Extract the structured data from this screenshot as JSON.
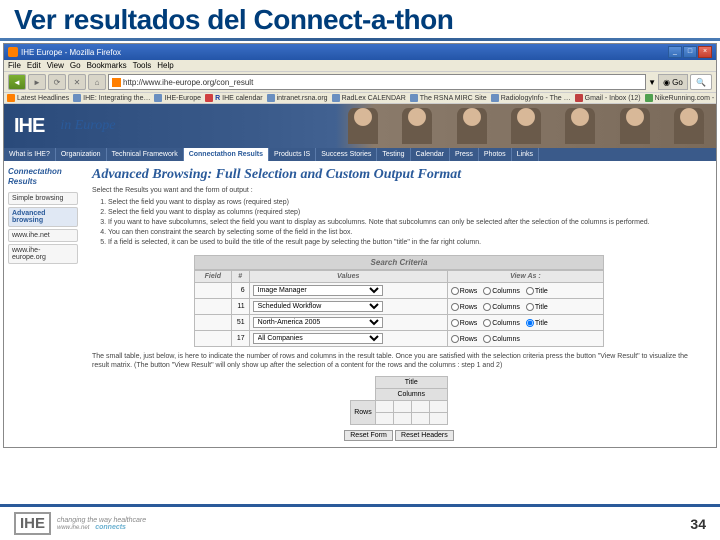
{
  "slide_title": "Ver resultados del Connect-a-thon",
  "browser": {
    "window_title": "IHE Europe - Mozilla Firefox",
    "menus": [
      "File",
      "Edit",
      "View",
      "Go",
      "Bookmarks",
      "Tools",
      "Help"
    ],
    "url": "http://www.ihe-europe.org/con_result",
    "go_label": "Go",
    "bookmarks": [
      "Latest Headlines",
      "IHE: Integrating the…",
      "IHE-Europe",
      "IHE calendar",
      "intranet.rsna.org",
      "RadLex CALENDAR",
      "The RSNA MIRC Site",
      "RadiologyInfo - The …",
      "Gmail - Inbox (12)",
      "NikeRunning.com - t…"
    ]
  },
  "topnav": [
    "What is IHE?",
    "Organization",
    "Technical Framework",
    "Connectathon Results",
    "Products IS",
    "Success Stories",
    "Testing",
    "Calendar",
    "Press",
    "Photos",
    "Links"
  ],
  "sidenav": {
    "header": "Connectathon Results",
    "items": [
      "Simple browsing",
      "Advanced browsing",
      "www.ihe.net",
      "www.ihe-europe.org"
    ]
  },
  "main": {
    "h1": "Advanced Browsing: Full Selection and Custom Output Format",
    "intro": "Select the Results you want and the form of output :",
    "steps": [
      "Select the field you want to display as rows (required step)",
      "Select the field you want to display as columns (required step)",
      "If you want to have subcolumns, select the field you want to display as subcolumns. Note that subcolumns can only be selected after the selection of the columns is performed.",
      "You can then constraint the search by selecting some of the field in the list box.",
      "If a field is selected, it can be used to build the title of the result page by selecting the button \"title\" in the far right column."
    ],
    "criteria_title": "Search Criteria",
    "headers": {
      "field": "Field",
      "num": "#",
      "values": "Values",
      "viewas": "View As :"
    },
    "rows": [
      {
        "id": "6",
        "value": "Image Manager",
        "rows": false,
        "cols": false,
        "title": false,
        "show_title": true
      },
      {
        "id": "11",
        "value": "Scheduled Workflow",
        "rows": false,
        "cols": false,
        "title": false,
        "show_title": true
      },
      {
        "id": "51",
        "value": "North-America 2005",
        "rows": false,
        "cols": false,
        "title": true,
        "show_title": true
      },
      {
        "id": "17",
        "value": "All Companies",
        "rows": false,
        "cols": false,
        "title": null,
        "show_title": false
      }
    ],
    "radio_labels": {
      "rows": "Rows",
      "cols": "Columns",
      "title": "Title"
    },
    "note": "The small table, just below, is here to indicate the number of rows and columns in the result table. Once you are satisfied with the selection criteria press the button \"View Result\" to visualize the result matrix. (The button \"View Result\" will only show up after the selection of a content for the rows and the columns : step 1 and 2)",
    "preview": {
      "title": "Title",
      "columns": "Columns",
      "rows": "Rows"
    },
    "buttons": {
      "reset_form": "Reset Form",
      "reset_headers": "Reset Headers"
    }
  },
  "footer": {
    "logo": "IHE",
    "tagline1": "changing the way healthcare",
    "tagline2": "connects",
    "site": "www.ihe.net",
    "page_number": "34"
  }
}
